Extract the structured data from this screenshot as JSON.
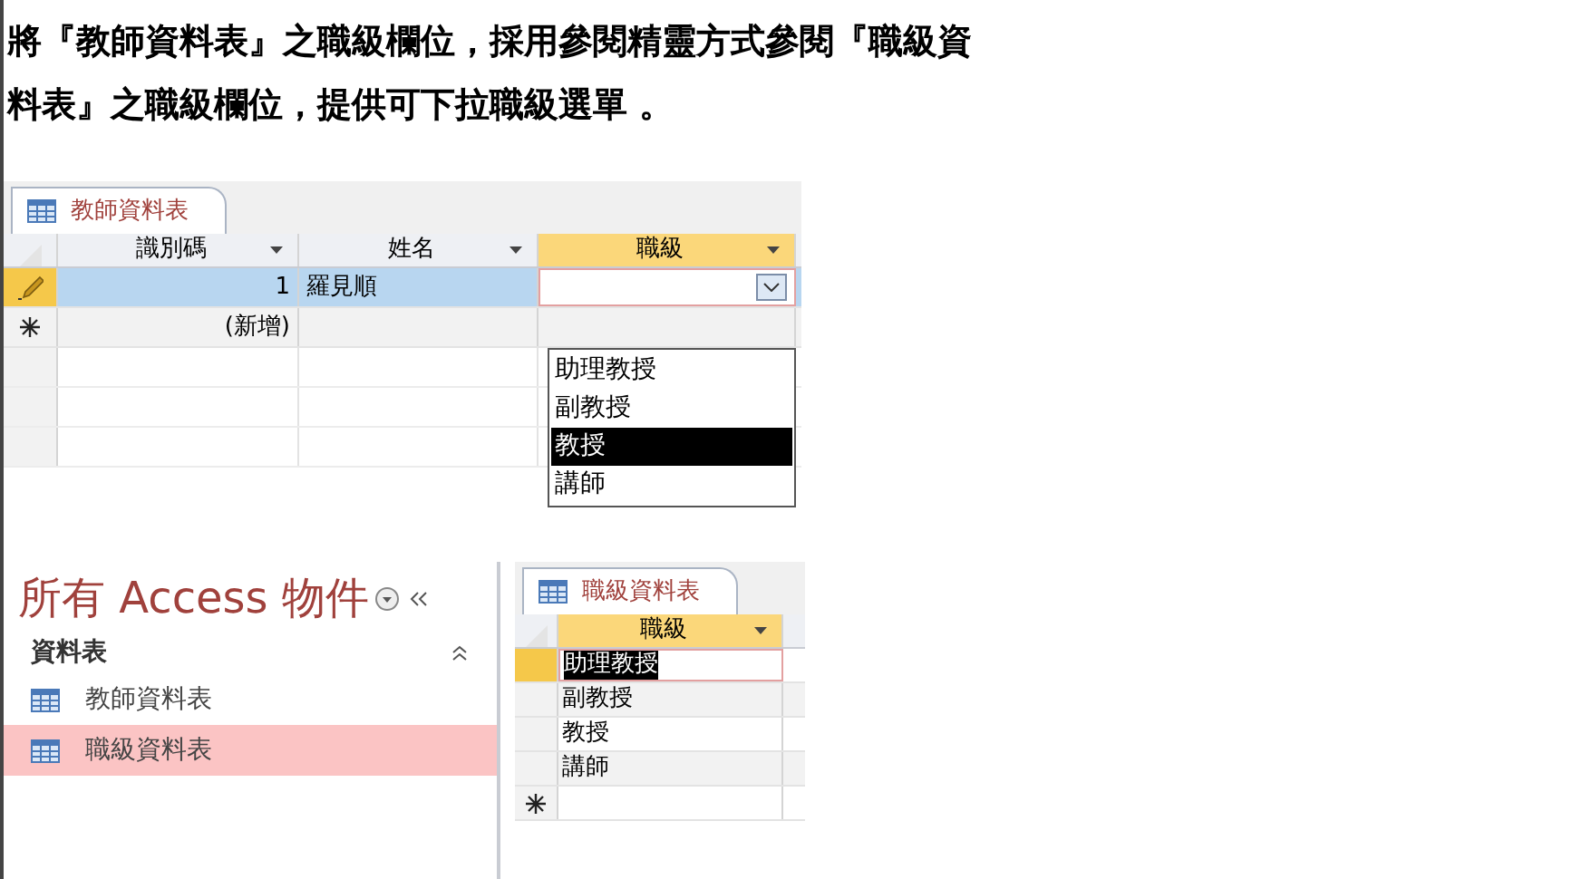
{
  "instruction": {
    "lines": [
      "將『教師資料表』之職級欄位，採用參閱精靈方式參閱『職級資",
      "料表』之職級欄位，提供可下拉職級選單 。"
    ]
  },
  "teacher_table": {
    "tab": {
      "label": "教師資料表",
      "selected": true
    },
    "columns": [
      {
        "label": "識別碼",
        "highlighted": false
      },
      {
        "label": "姓名",
        "highlighted": false
      },
      {
        "label": "職級",
        "highlighted": true
      }
    ],
    "rows": [
      {
        "kind": "editing",
        "cells": [
          "1",
          "羅見順",
          ""
        ]
      },
      {
        "kind": "new",
        "cells": [
          "(新增)",
          "",
          ""
        ]
      }
    ],
    "dropdown": {
      "options": [
        {
          "label": "助理教授",
          "selected": false
        },
        {
          "label": "副教授",
          "selected": false
        },
        {
          "label": "教授",
          "selected": true
        },
        {
          "label": "講師",
          "selected": false
        }
      ]
    }
  },
  "nav_pane": {
    "title": "所有 Access 物件",
    "group": {
      "label": "資料表",
      "expanded": true
    },
    "items": [
      {
        "label": "教師資料表",
        "selected": false
      },
      {
        "label": "職級資料表",
        "selected": true
      }
    ]
  },
  "rank_table": {
    "tab": {
      "label": "職級資料表",
      "selected": true
    },
    "column": {
      "label": "職級",
      "highlighted": true
    },
    "rows": [
      {
        "value": "助理教授",
        "selected": true
      },
      {
        "value": "副教授",
        "selected": false
      },
      {
        "value": "教授",
        "selected": false
      },
      {
        "value": "講師",
        "selected": false
      }
    ]
  }
}
